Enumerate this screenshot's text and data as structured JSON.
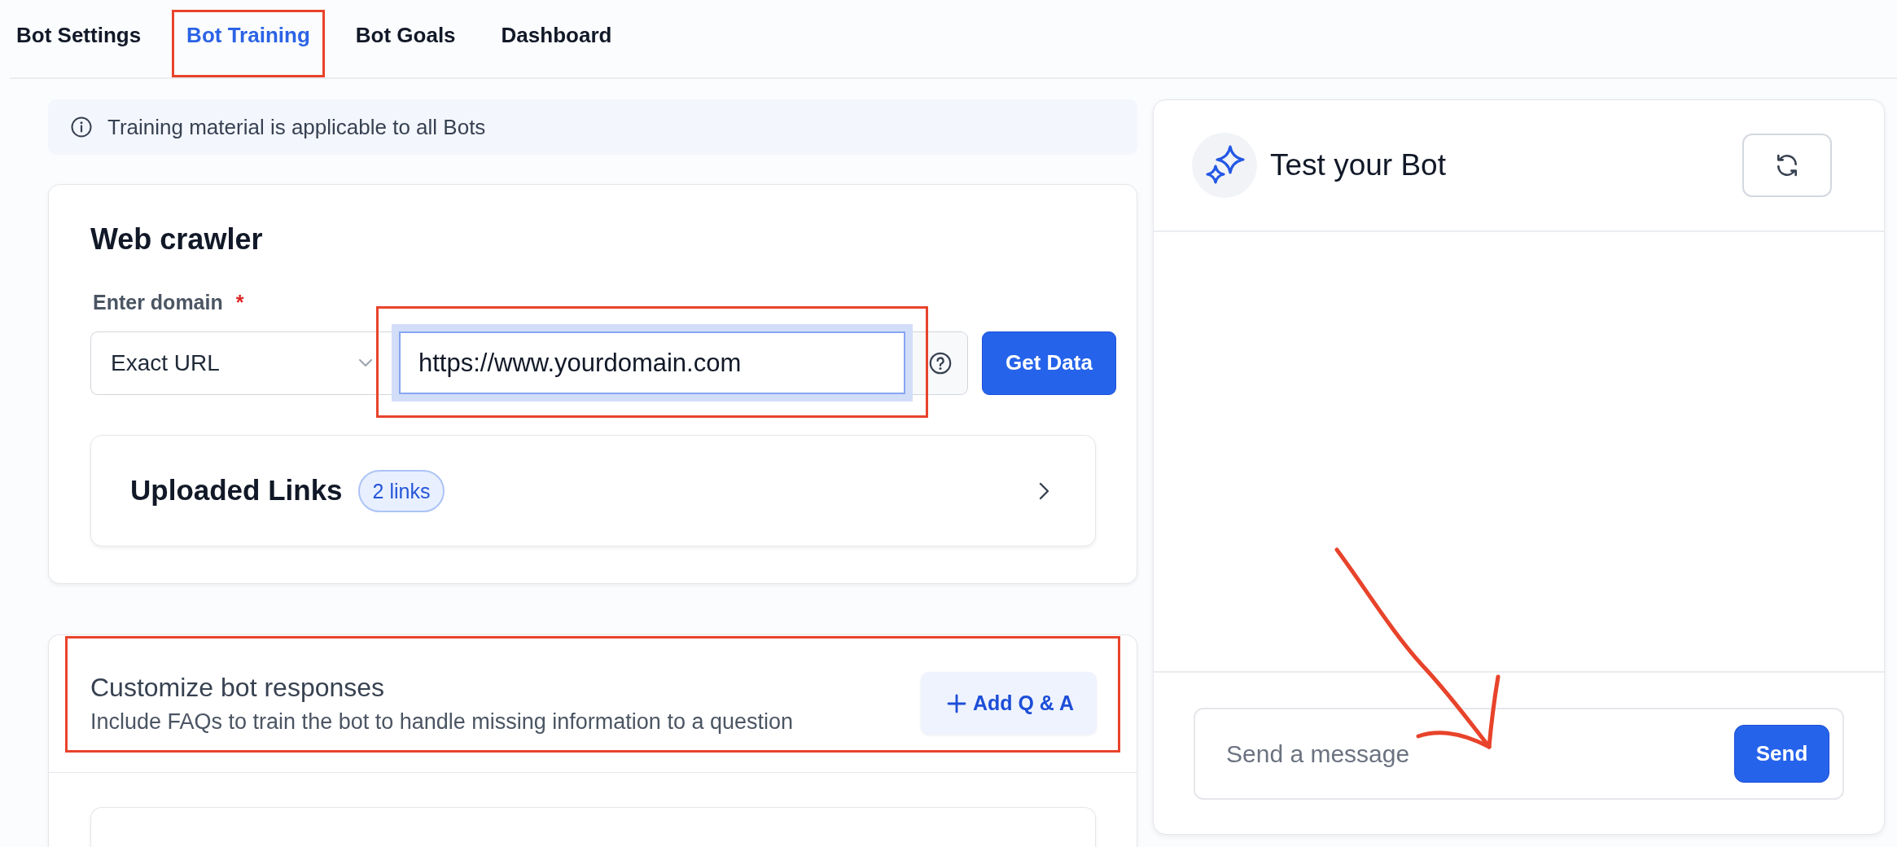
{
  "tabs": [
    {
      "label": "Bot Settings",
      "selected": false,
      "highlighted": false
    },
    {
      "label": "Bot Training",
      "selected": true,
      "highlighted": true
    },
    {
      "label": "Bot Goals",
      "selected": false,
      "highlighted": false
    },
    {
      "label": "Dashboard",
      "selected": false,
      "highlighted": false
    }
  ],
  "notice": {
    "text": "Training material is applicable to all Bots"
  },
  "web_crawler": {
    "title": "Web crawler",
    "domain_label": "Enter domain",
    "required_mark": "*",
    "match_type": "Exact URL",
    "url": "https://www.yourdomain.com",
    "url_focused": true,
    "url_highlighted": true,
    "submit_button": "Get Data",
    "uploaded_links": {
      "title": "Uploaded Links",
      "count": "2 links"
    }
  },
  "bot_responses": {
    "title": "Customize bot responses",
    "description": "Include FAQs to train the bot to handle missing information to a question",
    "add_button": "Add Q & A",
    "highlighted": true
  },
  "test_panel": {
    "title": "Test your Bot",
    "message_placeholder": "Send a message",
    "send_button": "Send",
    "arrow_annotation": true
  }
}
